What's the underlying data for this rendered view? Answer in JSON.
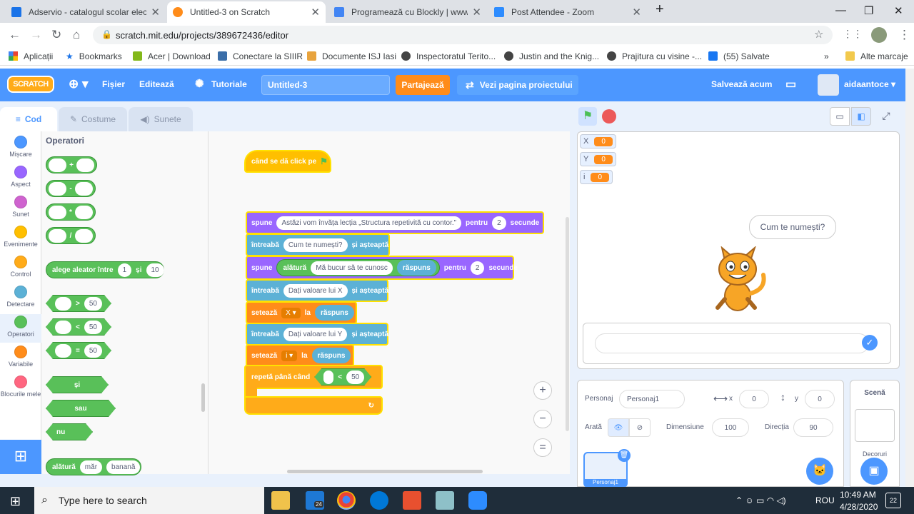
{
  "browser": {
    "tabs": [
      {
        "label": "Adservio - catalogul scolar elect",
        "icon_color": "#1a73e8"
      },
      {
        "label": "Untitled-3 on Scratch",
        "icon_color": "#ff8c1a"
      },
      {
        "label": "Programează cu Blockly | www.pl",
        "icon_color": "#4285f4"
      },
      {
        "label": "Post Attendee - Zoom",
        "icon_color": "#2d8cff"
      }
    ],
    "url": "scratch.mit.edu/projects/389672436/editor",
    "bookmarks": [
      "Aplicații",
      "Bookmarks",
      "Acer | Download",
      "Conectare la SIIIR",
      "Documente ISJ Iasi",
      "Inspectoratul Terito...",
      "Justin and the Knig...",
      "Prajitura cu visine -...",
      "(55) Salvate",
      "Alte marcaje"
    ]
  },
  "menu": {
    "logo": "SCRATCH",
    "file": "Fișier",
    "edit": "Editează",
    "tutorials": "Tutoriale",
    "project_title": "Untitled-3",
    "share": "Partajează",
    "see_project": "Vezi pagina proiectului",
    "save_now": "Salvează acum",
    "username": "aidaantoce"
  },
  "editor_tabs": {
    "code": "Cod",
    "costumes": "Costume",
    "sounds": "Sunete"
  },
  "categories": [
    {
      "label": "Mișcare",
      "color": "#4c97ff"
    },
    {
      "label": "Aspect",
      "color": "#9966ff"
    },
    {
      "label": "Sunet",
      "color": "#cf63cf"
    },
    {
      "label": "Evenimente",
      "color": "#ffbf00"
    },
    {
      "label": "Control",
      "color": "#ffab19"
    },
    {
      "label": "Detectare",
      "color": "#5cb1d6"
    },
    {
      "label": "Operatori",
      "color": "#59c059"
    },
    {
      "label": "Variabile",
      "color": "#ff8c1a"
    },
    {
      "label": "Blocurile mele",
      "color": "#ff6680"
    }
  ],
  "palette": {
    "heading": "Operatori",
    "add": "+",
    "sub": "-",
    "mul": "*",
    "div": "/",
    "random_label": "alege aleator între",
    "random_from": "1",
    "random_and": "și",
    "random_to": "10",
    "gt": ">",
    "lt": "<",
    "eq": "=",
    "cmp_value": "50",
    "and": "și",
    "or": "sau",
    "not": "nu",
    "join": "alătură",
    "join_a": "măr",
    "join_b": "banană"
  },
  "script": {
    "hat": "când se dă click pe",
    "say1": "spune",
    "say1_text": "Astăzi vom învăța lecția „Structura repetivită cu contor.”",
    "say1_for": "pentru",
    "say1_secs": "2",
    "say1_unit": "secunde",
    "ask1": "întreabă",
    "ask1_text": "Cum te numești?",
    "ask1_wait": "și așteaptă",
    "say2": "spune",
    "say2_join": "alătură",
    "say2_text": "Mă bucur să te cunosc",
    "say2_answer": "răspuns",
    "say2_for": "pentru",
    "say2_secs": "2",
    "say2_unit": "secunde",
    "ask2": "întreabă",
    "ask2_text": "Dați valoare lui X",
    "ask2_wait": "și așteaptă",
    "set1": "setează",
    "set1_var": "X ▾",
    "set1_to": "la",
    "set1_val": "răspuns",
    "ask3": "întreabă",
    "ask3_text": "Dați valoare lui Y",
    "ask3_wait": "și așteaptă",
    "set2": "setează",
    "set2_var": "i ▾",
    "set2_to": "la",
    "set2_val": "răspuns",
    "repeat": "repetă până când",
    "repeat_op": "<",
    "repeat_val": "50",
    "zoom_in": "+",
    "zoom_out": "−",
    "zoom_reset": "="
  },
  "stage": {
    "monitors": [
      {
        "label": "X",
        "value": "0"
      },
      {
        "label": "Y",
        "value": "0"
      },
      {
        "label": "i",
        "value": "0"
      }
    ],
    "speech": "Cum te numești?"
  },
  "sprite_info": {
    "sprite_label": "Personaj",
    "sprite_name": "Personaj1",
    "x_label": "x",
    "x_value": "0",
    "y_label": "y",
    "y_value": "0",
    "show_label": "Arată",
    "size_label": "Dimensiune",
    "size_value": "100",
    "direction_label": "Direcția",
    "direction_value": "90",
    "thumb_label": "Personaj1"
  },
  "stage_panel": {
    "title": "Scenă",
    "backdrops": "Decoruri"
  },
  "taskbar": {
    "search": "Type here to search",
    "lang": "ROU",
    "time": "10:49 AM",
    "date": "4/28/2020",
    "notif_count": "22",
    "mail_badge": "24"
  }
}
